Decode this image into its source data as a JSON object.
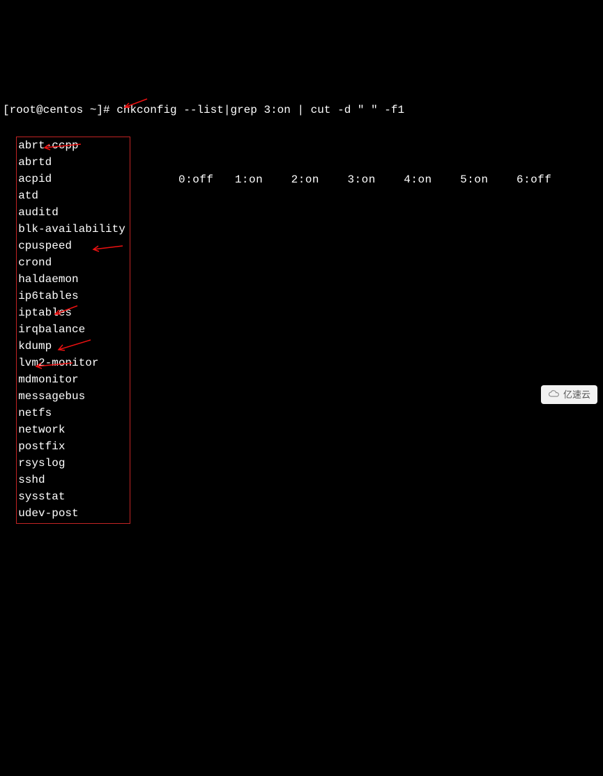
{
  "prompt": {
    "user_host": "[root@centos ~]# ",
    "command": "chkconfig --list|grep 3:on | cut -d \" \" -f1"
  },
  "services": [
    "abrt-ccpp",
    "abrtd",
    "acpid",
    "atd",
    "auditd",
    "blk-availability",
    "cpuspeed",
    "crond",
    "haldaemon",
    "ip6tables",
    "iptables",
    "irqbalance",
    "kdump",
    "lvm2-monitor",
    "mdmonitor",
    "messagebus",
    "netfs",
    "network",
    "postfix",
    "rsyslog",
    "sshd",
    "sysstat",
    "udev-post"
  ],
  "runlevels": "0:off   1:on    2:on    3:on    4:on    5:on    6:off",
  "watermark": "亿速云"
}
